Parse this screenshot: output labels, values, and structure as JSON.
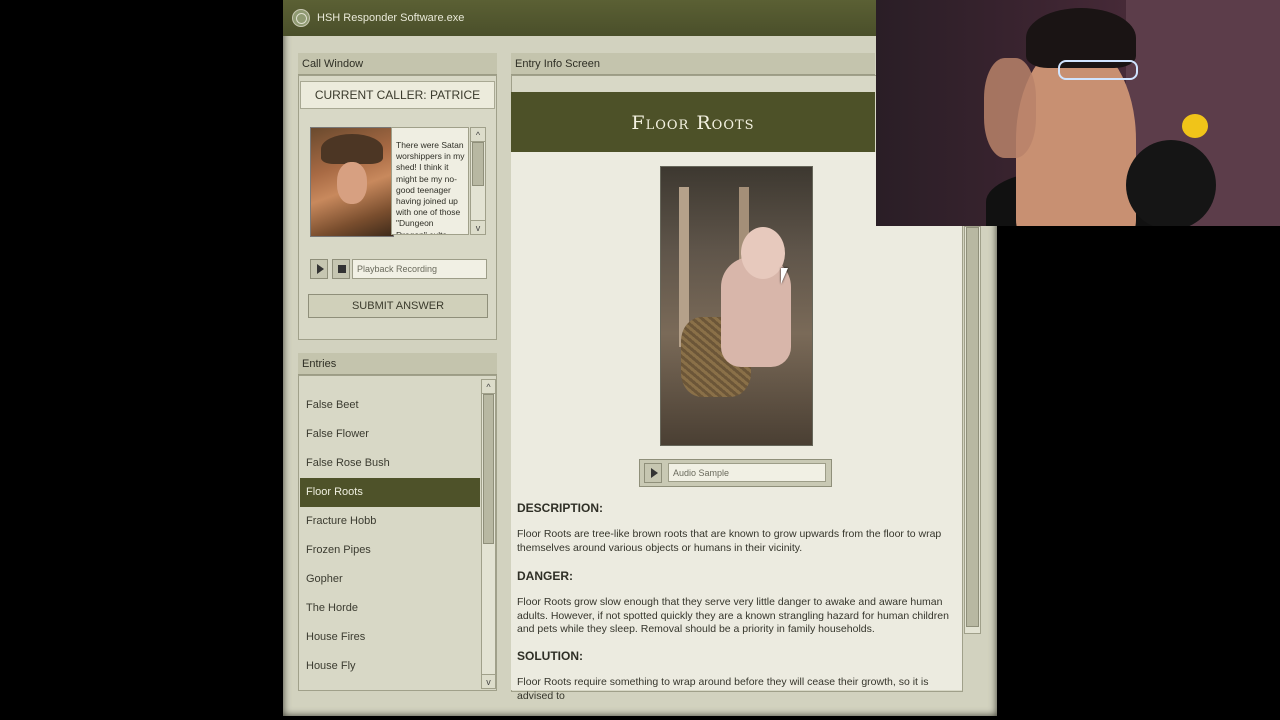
{
  "app": {
    "title": "HSH Responder Software.exe"
  },
  "call_window": {
    "header": "Call Window",
    "caller_label": "CURRENT CALLER: PATRICE",
    "transcript": "There were Satan worshippers in my shed! I think it might be my no-good teenager having joined up with one of those \"Dungeon Dragon\" cults they say those days...",
    "scroll_up": "^",
    "scroll_down": "v",
    "playback_placeholder": "Playback Recording",
    "submit_label": "SUBMIT ANSWER"
  },
  "entries": {
    "header": "Entries",
    "scroll_up": "^",
    "scroll_down": "v",
    "items": [
      {
        "label": "False Beet"
      },
      {
        "label": "False Flower"
      },
      {
        "label": "False Rose Bush"
      },
      {
        "label": "Floor Roots"
      },
      {
        "label": "Fracture Hobb"
      },
      {
        "label": "Frozen Pipes"
      },
      {
        "label": "Gopher"
      },
      {
        "label": "The Horde"
      },
      {
        "label": "House Fires"
      },
      {
        "label": "House Fly"
      }
    ],
    "selected": "Floor Roots"
  },
  "entry_info": {
    "header": "Entry Info Screen",
    "title": "Floor Roots",
    "audio_label": "Audio Sample",
    "description_heading": "DESCRIPTION:",
    "description_text": "Floor Roots are tree-like brown roots that are known to grow upwards from the floor to wrap themselves around various objects or humans in their vicinity.",
    "danger_heading": "DANGER:",
    "danger_text": "Floor Roots grow slow enough that they serve very little danger to awake and aware human adults. However, if not spotted quickly they are a known strangling hazard for human children and pets while they sleep. Removal should be a priority in family households.",
    "solution_heading": "SOLUTION:",
    "solution_text": "Floor Roots require something to wrap around before they will cease their growth, so it is advised to"
  },
  "colors": {
    "accent": "#4d5128",
    "panel": "#d2d2bf",
    "paper": "#ecebe0"
  }
}
